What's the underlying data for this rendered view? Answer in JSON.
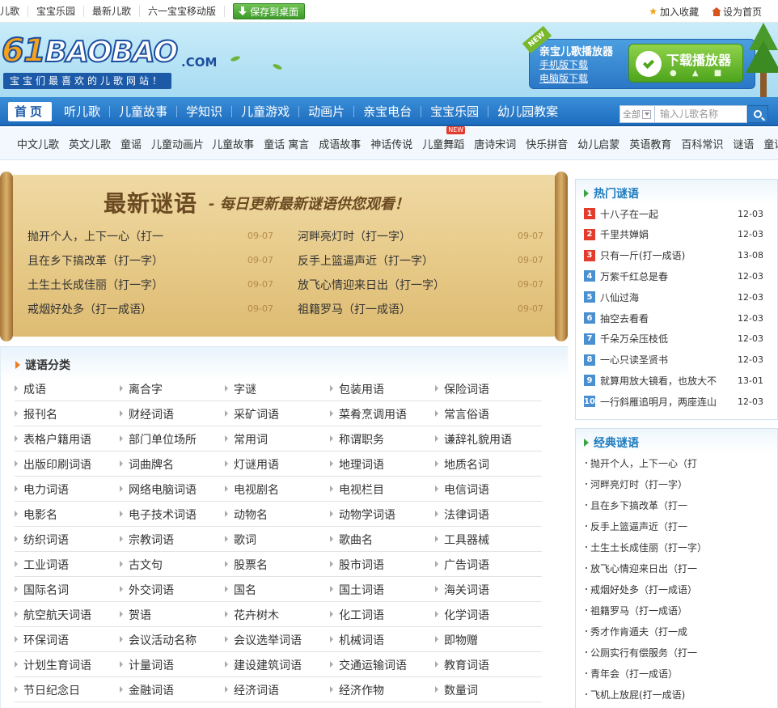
{
  "topbar": {
    "links": [
      "儿歌",
      "宝宝乐园",
      "最新儿歌",
      "六一宝宝移动版"
    ],
    "save_label": "保存到桌面",
    "favorite_label": "加入收藏",
    "homepage_label": "设为首页"
  },
  "header": {
    "logo_num": "61",
    "logo_word": "BAOBAO",
    "logo_com": ".COM",
    "slogan": "宝宝们最喜欢的儿歌网站！",
    "player": {
      "ribbon": "NEW",
      "title": "亲宝儿歌播放器",
      "mobile_link": "手机版下载",
      "pc_link": "电脑版下载",
      "download_label": "下载播放器"
    }
  },
  "nav": {
    "items": [
      "首页",
      "听儿歌",
      "儿童故事",
      "学知识",
      "儿童游戏",
      "动画片",
      "亲宝电台",
      "宝宝乐园",
      "幼儿园教案"
    ],
    "search_scope": "全部",
    "search_placeholder": "输入儿歌名称"
  },
  "subnav": {
    "items": [
      "中文儿歌",
      "英文儿歌",
      "童谣",
      "儿童动画片",
      "儿童故事",
      "童话 寓言",
      "成语故事",
      "神话传说",
      "儿童舞蹈",
      "唐诗宋词",
      "快乐拼音",
      "幼儿启蒙",
      "英语教育",
      "百科常识",
      "谜语",
      "童话故事"
    ],
    "new_badge": "NEW"
  },
  "banner": {
    "title": "最新谜语",
    "subtitle": "- 每日更新最新谜语供您观看！",
    "rows": [
      {
        "left": "抛开个人，上下一心（打一",
        "left_date": "09-07",
        "right": "河畔亮灯时（打一字）",
        "right_date": "09-07"
      },
      {
        "left": "且在乡下搞改革（打一字）",
        "left_date": "09-07",
        "right": "反手上篮逼声近（打一字）",
        "right_date": "09-07"
      },
      {
        "left": "土生土长成佳丽（打一字）",
        "left_date": "09-07",
        "right": "放飞心情迎来日出（打一字）",
        "right_date": "09-07"
      },
      {
        "left": "戒烟好处多（打一成语）",
        "left_date": "09-07",
        "right": "祖籍罗马（打一成语）",
        "right_date": "09-07"
      }
    ]
  },
  "categories": {
    "title": "谜语分类",
    "rows": [
      [
        "成语",
        "离合字",
        "字谜",
        "包装用语",
        "保险词语"
      ],
      [
        "报刊名",
        "财经词语",
        "采矿词语",
        "菜肴烹调用语",
        "常言俗语"
      ],
      [
        "表格户籍用语",
        "部门单位场所",
        "常用词",
        "称谓职务",
        "谦辞礼貌用语"
      ],
      [
        "出版印刷词语",
        "词曲牌名",
        "灯谜用语",
        "地理词语",
        "地质名词"
      ],
      [
        "电力词语",
        "网络电脑词语",
        "电视剧名",
        "电视栏目",
        "电信词语"
      ],
      [
        "电影名",
        "电子技术词语",
        "动物名",
        "动物学词语",
        "法律词语"
      ],
      [
        "纺织词语",
        "宗教词语",
        "歌词",
        "歌曲名",
        "工具器械"
      ],
      [
        "工业词语",
        "古文句",
        "股票名",
        "股市词语",
        "广告词语"
      ],
      [
        "国际名词",
        "外交词语",
        "国名",
        "国土词语",
        "海关词语"
      ],
      [
        "航空航天词语",
        "贺语",
        "花卉树木",
        "化工词语",
        "化学词语"
      ],
      [
        "环保词语",
        "会议活动名称",
        "会议选举词语",
        "机械词语",
        "即物赠"
      ],
      [
        "计划生育词语",
        "计量词语",
        "建设建筑词语",
        "交通运输词语",
        "教育词语"
      ],
      [
        "节日纪念日",
        "金融词语",
        "经济词语",
        "经济作物",
        "数量词"
      ]
    ]
  },
  "hot": {
    "title": "热门谜语",
    "items": [
      {
        "n": "1",
        "title": "十八子在一起",
        "date": "12-03"
      },
      {
        "n": "2",
        "title": "千里共婵娟",
        "date": "12-03"
      },
      {
        "n": "3",
        "title": "只有一斤(打一成语)",
        "date": "13-08"
      },
      {
        "n": "4",
        "title": "万紫千红总是春",
        "date": "12-03"
      },
      {
        "n": "5",
        "title": "八仙过海",
        "date": "12-03"
      },
      {
        "n": "6",
        "title": "抽空去看看",
        "date": "12-03"
      },
      {
        "n": "7",
        "title": "千朵万朵压枝低",
        "date": "12-03"
      },
      {
        "n": "8",
        "title": "一心只读圣贤书",
        "date": "12-03"
      },
      {
        "n": "9",
        "title": "就算用放大镜看，也放大不",
        "date": "13-01"
      },
      {
        "n": "10",
        "title": "一行斜雁追明月，两座连山",
        "date": "12-03"
      }
    ]
  },
  "classic": {
    "title": "经典谜语",
    "items": [
      "抛开个人，上下一心（打",
      "河畔亮灯时（打一字）",
      "且在乡下搞改革（打一",
      "反手上篮逼声近（打一",
      "土生土长成佳丽（打一字）",
      "放飞心情迎来日出（打一",
      "戒烟好处多（打一成语）",
      "祖籍罗马（打一成语）",
      "秀才作肯遁夫（打一成",
      "公厕实行有偿服务（打一",
      "青年会（打一成语）",
      "飞机上放屁(打一成语)"
    ]
  },
  "colors": {
    "nav": "#1e6dbf",
    "accent_green": "#4ea51d",
    "hot_red": "#e33b2c",
    "hot_blue": "#4a90d0"
  }
}
